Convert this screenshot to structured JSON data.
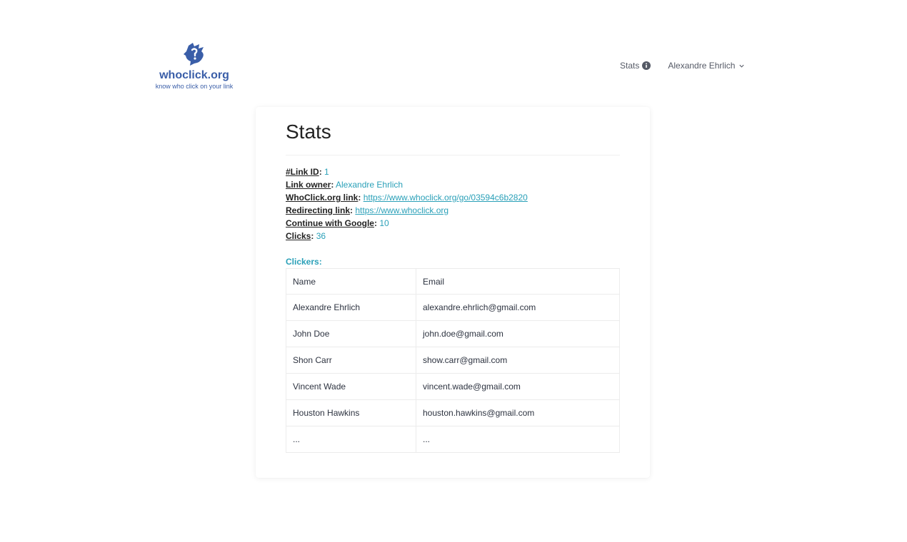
{
  "brand": {
    "name": "whoclick.org",
    "tagline": "know who click on your link",
    "color": "#3a5ea8"
  },
  "nav": {
    "stats_label": "Stats",
    "user_label": "Alexandre Ehrlich"
  },
  "page": {
    "title": "Stats"
  },
  "info": {
    "link_id_label": "#Link ID",
    "link_id_value": "1",
    "owner_label": "Link owner",
    "owner_value": "Alexandre Ehrlich",
    "whoclick_label": "WhoClick.org link",
    "whoclick_value": "https://www.whoclick.org/go/03594c6b2820",
    "redirect_label": "Redirecting link",
    "redirect_value": "https://www.whoclick.org",
    "google_label": "Continue with Google",
    "google_value": "10",
    "clicks_label": "Clicks",
    "clicks_value": "36"
  },
  "clickers": {
    "heading": "Clickers:",
    "columns": [
      "Name",
      "Email"
    ],
    "rows": [
      {
        "name": "Alexandre Ehrlich",
        "email": "alexandre.ehrlich@gmail.com"
      },
      {
        "name": "John Doe",
        "email": "john.doe@gmail.com"
      },
      {
        "name": "Shon Carr",
        "email": "show.carr@gmail.com"
      },
      {
        "name": "Vincent Wade",
        "email": "vincent.wade@gmail.com"
      },
      {
        "name": "Houston Hawkins",
        "email": "houston.hawkins@gmail.com"
      },
      {
        "name": "...",
        "email": "..."
      }
    ]
  },
  "colors": {
    "accent": "#2aa0b8",
    "text": "#222222"
  }
}
